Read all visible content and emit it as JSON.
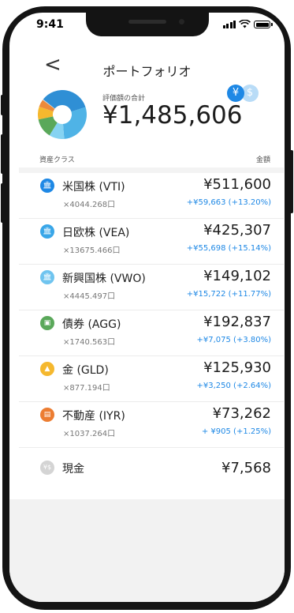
{
  "status": {
    "time": "9:41"
  },
  "nav": {
    "back_icon": "chevron-left-icon",
    "back_glyph": "<",
    "title": "ポートフォリオ"
  },
  "summary": {
    "label": "評価額の合計",
    "total": "¥1,485,606",
    "chart": {
      "type": "donut",
      "segments": [
        {
          "name": "米国株 (VTI)",
          "value": 511600,
          "color": "#2f8fd5"
        },
        {
          "name": "日欧株 (VEA)",
          "value": 425307,
          "color": "#4fb3e6"
        },
        {
          "name": "新興国株 (VWO)",
          "value": 149102,
          "color": "#86d3f2"
        },
        {
          "name": "債券 (AGG)",
          "value": 192837,
          "color": "#5aa85a"
        },
        {
          "name": "金 (GLD)",
          "value": 125930,
          "color": "#f5b82e"
        },
        {
          "name": "不動産 (IYR)",
          "value": 73262,
          "color": "#ec8a3a"
        },
        {
          "name": "現金",
          "value": 7568,
          "color": "#cfcfcf"
        }
      ]
    },
    "currency_toggle": {
      "yen": "¥",
      "usd": "$"
    }
  },
  "table": {
    "col_class": "資産クラス",
    "col_amount": "金額"
  },
  "assets": [
    {
      "name": "米国株 (VTI)",
      "qty": "×4044.268口",
      "amount": "¥511,600",
      "change": "+¥59,663 (+13.20%)",
      "icon": "building-icon",
      "icon_glyph": "🏛",
      "color": "#1e88e5"
    },
    {
      "name": "日欧株 (VEA)",
      "qty": "×13675.466口",
      "amount": "¥425,307",
      "change": "+¥55,698 (+15.14%)",
      "icon": "building-icon",
      "icon_glyph": "🏛",
      "color": "#39a6e8"
    },
    {
      "name": "新興国株 (VWO)",
      "qty": "×4445.497口",
      "amount": "¥149,102",
      "change": "+¥15,722 (+11.77%)",
      "icon": "building-icon",
      "icon_glyph": "🏛",
      "color": "#6fc4ef"
    },
    {
      "name": "債券 (AGG)",
      "qty": "×1740.563口",
      "amount": "¥192,837",
      "change": "+¥7,075 (+3.80%)",
      "icon": "bond-icon",
      "icon_glyph": "▣",
      "color": "#5aa85a"
    },
    {
      "name": "金 (GLD)",
      "qty": "×877.194口",
      "amount": "¥125,930",
      "change": "+¥3,250 (+2.64%)",
      "icon": "gold-bars-icon",
      "icon_glyph": "▲",
      "color": "#f5b82e"
    },
    {
      "name": "不動産 (IYR)",
      "qty": "×1037.264口",
      "amount": "¥73,262",
      "change": "+ ¥905 (+1.25%)",
      "icon": "real-estate-icon",
      "icon_glyph": "▤",
      "color": "#ec7d32"
    }
  ],
  "cash": {
    "name": "現金",
    "amount": "¥7,568",
    "icon": "cash-icon",
    "icon_glyph": "¥$"
  }
}
